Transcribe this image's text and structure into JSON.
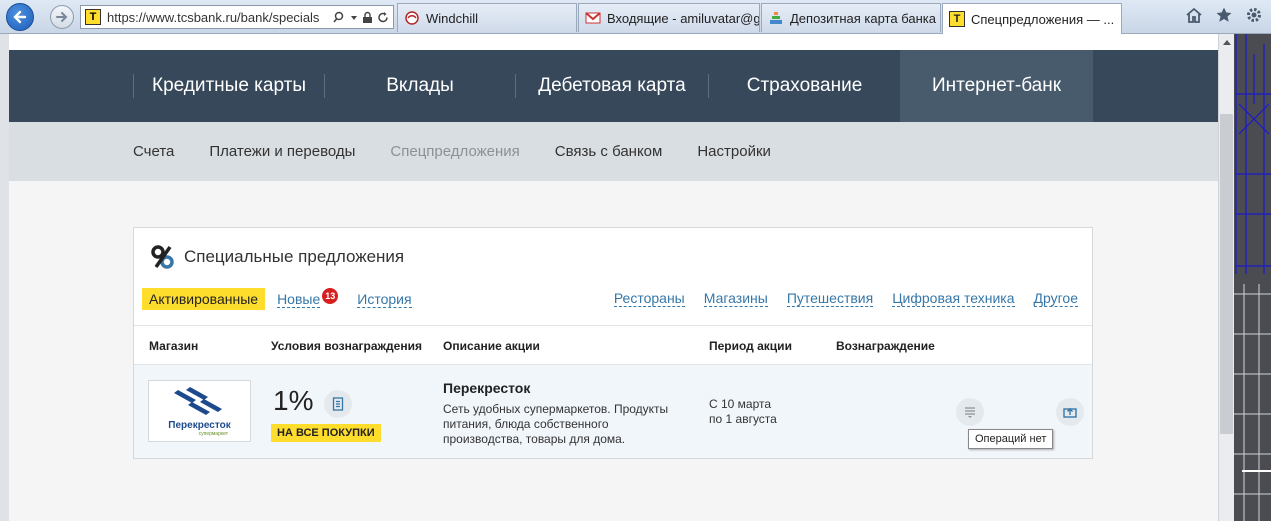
{
  "browser": {
    "url": "https://www.tcsbank.ru/bank/specials",
    "tabs": [
      {
        "label": "Windchill"
      },
      {
        "label": "Входящие - amiluvatar@g..."
      },
      {
        "label": "Депозитная карта банка Т..."
      },
      {
        "label": "Спецпредложения — ...",
        "active": true
      }
    ],
    "close_glyph": "×"
  },
  "main_nav": [
    "Кредитные карты",
    "Вклады",
    "Дебетовая карта",
    "Страхование",
    "Интернет-банк"
  ],
  "sub_nav": [
    "Счета",
    "Платежи и переводы",
    "Спецпредложения",
    "Связь с банком",
    "Настройки"
  ],
  "panel": {
    "title": "Специальные предложения",
    "filters": {
      "activated": "Активированные",
      "new": "Новые",
      "new_count": "13",
      "history": "История"
    },
    "categories": [
      "Рестораны",
      "Магазины",
      "Путешествия",
      "Цифровая техника",
      "Другое"
    ],
    "columns": [
      "Магазин",
      "Условия вознаграждения",
      "Описание акции",
      "Период акции",
      "Вознаграждение"
    ],
    "offer": {
      "logo_name": "Перекресток",
      "logo_sub": "супермаркет",
      "percent": "1%",
      "badge": "НА ВСЕ ПОКУПКИ",
      "store": "Перекресток",
      "description": "Сеть удобных супермаркетов. Продукты питания, блюда собственного производства, товары для дома.",
      "period_from": "С 10 марта",
      "period_to": "по 1 августа",
      "tooltip": "Операций нет"
    }
  },
  "colors": {
    "nav_bg": "#36485a",
    "accent_yellow": "#ffdd2d",
    "link": "#3677a8",
    "badge_red": "#d6201f"
  }
}
